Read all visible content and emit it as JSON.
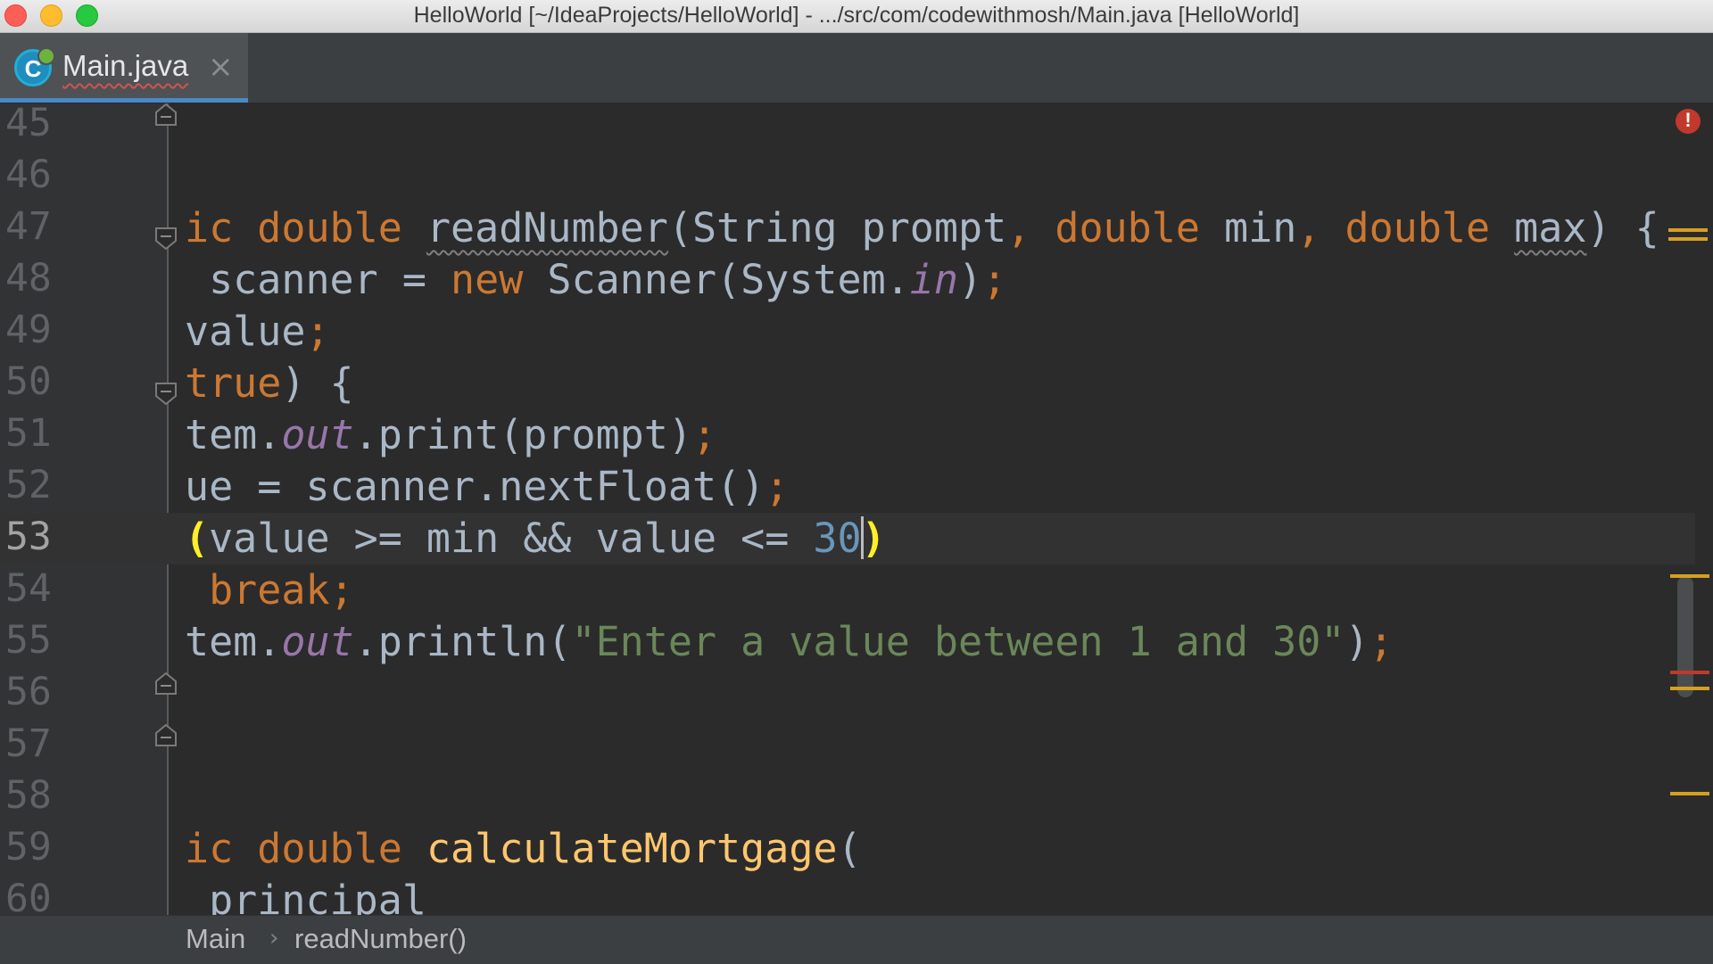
{
  "window": {
    "title": "HelloWorld [~/IdeaProjects/HelloWorld] - .../src/com/codewithmosh/Main.java [HelloWorld]"
  },
  "tabs": [
    {
      "label": "Main.java",
      "icon": "java-class-icon",
      "icon_letter": "C",
      "active": true
    }
  ],
  "editor": {
    "current_line": "53",
    "lines": [
      {
        "n": "45"
      },
      {
        "n": "46"
      },
      {
        "n": "47",
        "t": [
          {
            "c": "kw",
            "s": "ic double "
          },
          {
            "c": "warn",
            "s": "readNumber"
          },
          {
            "c": "",
            "s": "(String prompt"
          },
          {
            "c": "kw",
            "s": ", double "
          },
          {
            "c": "",
            "s": "min"
          },
          {
            "c": "kw",
            "s": ", double "
          },
          {
            "c": "warn",
            "s": "max"
          },
          {
            "c": "",
            "s": ") {"
          }
        ]
      },
      {
        "n": "48",
        "t": [
          {
            "c": "",
            "s": " scanner = "
          },
          {
            "c": "kw",
            "s": "new "
          },
          {
            "c": "",
            "s": "Scanner(System."
          },
          {
            "c": "fld",
            "s": "in"
          },
          {
            "c": "",
            "s": ")"
          },
          {
            "c": "semi",
            "s": ";"
          }
        ]
      },
      {
        "n": "49",
        "t": [
          {
            "c": "",
            "s": "value"
          },
          {
            "c": "semi",
            "s": ";"
          }
        ]
      },
      {
        "n": "50",
        "t": [
          {
            "c": "kw",
            "s": "true"
          },
          {
            "c": "",
            "s": ") {"
          }
        ]
      },
      {
        "n": "51",
        "t": [
          {
            "c": "",
            "s": "tem."
          },
          {
            "c": "fld",
            "s": "out"
          },
          {
            "c": "",
            "s": ".print(prompt)"
          },
          {
            "c": "semi",
            "s": ";"
          }
        ]
      },
      {
        "n": "52",
        "t": [
          {
            "c": "",
            "s": "ue = scanner.nextFloat()"
          },
          {
            "c": "semi",
            "s": ";"
          }
        ]
      },
      {
        "n": "53",
        "t": [
          {
            "c": "brace",
            "s": "("
          },
          {
            "c": "",
            "s": "value >= min && value <= "
          },
          {
            "c": "num",
            "s": "30"
          },
          {
            "c": "caret",
            "s": ""
          },
          {
            "c": "brace",
            "s": ")"
          }
        ]
      },
      {
        "n": "54",
        "t": [
          {
            "c": "kw",
            "s": " break;"
          }
        ]
      },
      {
        "n": "55",
        "t": [
          {
            "c": "",
            "s": "tem."
          },
          {
            "c": "fld",
            "s": "out"
          },
          {
            "c": "",
            "s": ".println("
          },
          {
            "c": "str",
            "s": "\"Enter a value between 1 and 30\""
          },
          {
            "c": "",
            "s": ")"
          },
          {
            "c": "semi",
            "s": ";"
          }
        ]
      },
      {
        "n": "56"
      },
      {
        "n": "57"
      },
      {
        "n": "58"
      },
      {
        "n": "59",
        "t": [
          {
            "c": "kw",
            "s": "ic double "
          },
          {
            "c": "fn",
            "s": "calculateMortgage"
          },
          {
            "c": "",
            "s": "("
          }
        ]
      },
      {
        "n": "60",
        "t": [
          {
            "c": "",
            "s": " principal"
          }
        ]
      }
    ]
  },
  "breadcrumb": {
    "class_name": "Main",
    "method_name": "readNumber()"
  },
  "colors": {
    "keyword": "#cc7832",
    "string": "#6a8759",
    "number": "#6897bb",
    "field": "#9876aa",
    "method_decl": "#ffc66d",
    "error": "#c0392b",
    "warning_marker": "#d4a020"
  }
}
